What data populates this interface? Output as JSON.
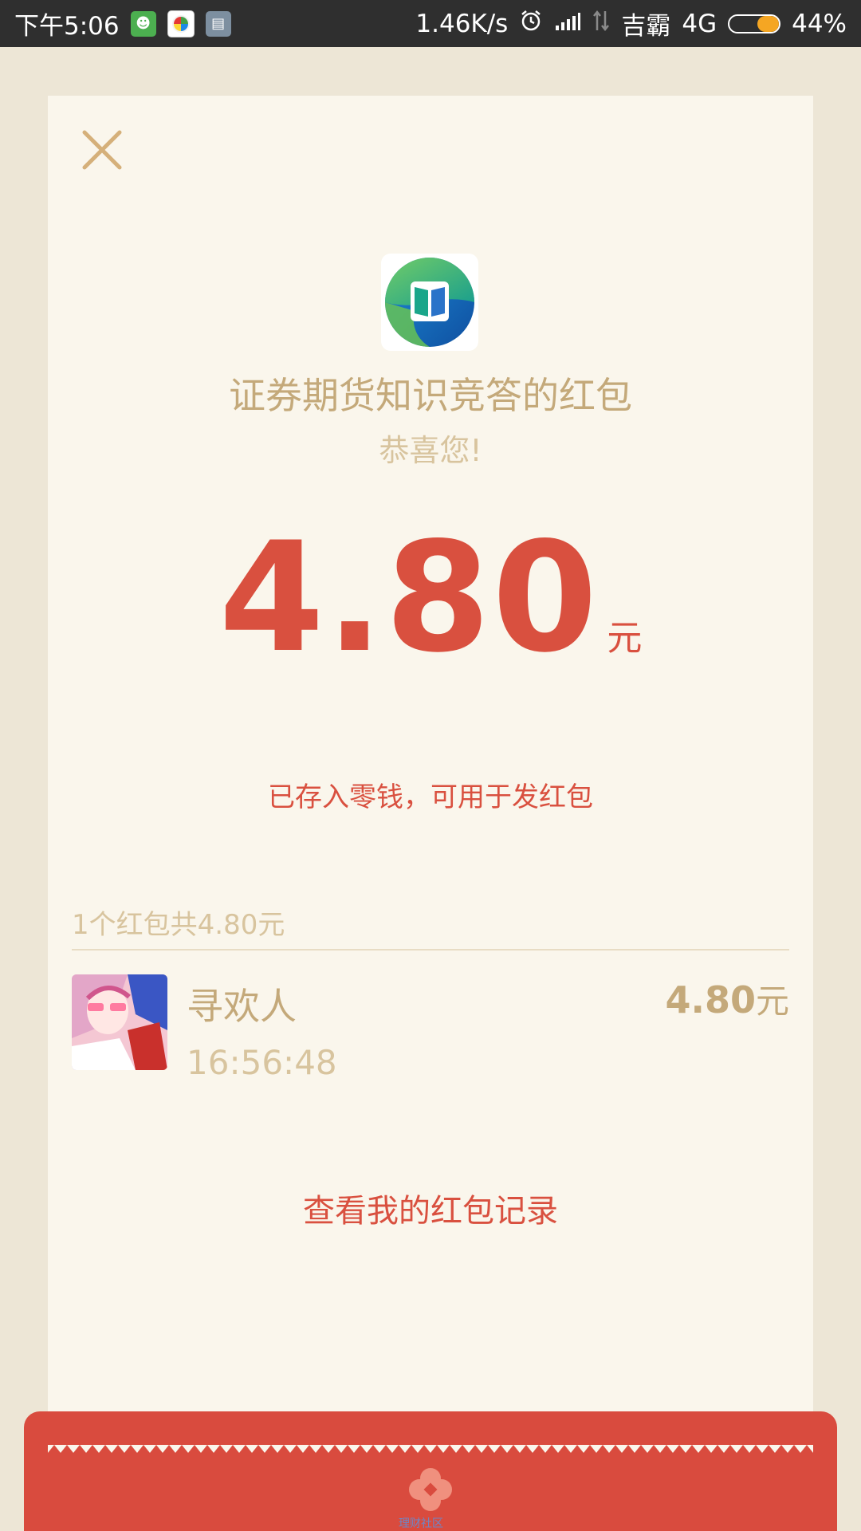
{
  "status_bar": {
    "time": "下午5:06",
    "speed": "1.46K/s",
    "carrier": "吉霸",
    "network": "4G",
    "battery": "44%",
    "battery_level": 0.44
  },
  "packet": {
    "title": "证券期货知识竞答的红包",
    "greeting": "恭喜您!",
    "amount": "4.80",
    "amount_unit": "元",
    "deposited_text": "已存入零钱，可用于发红包",
    "summary": "1个红包共4.80元",
    "entry": {
      "name": "寻欢人",
      "time": "16:56:48",
      "amount": "4.80",
      "unit": "元"
    },
    "records_link": "查看我的红包记录"
  },
  "footer": {
    "brand": "理财社区"
  },
  "colors": {
    "accent_red": "#d9503f",
    "gold": "#c4a97a",
    "card_bg": "#faf6ec",
    "page_bg": "#ede6d6"
  }
}
